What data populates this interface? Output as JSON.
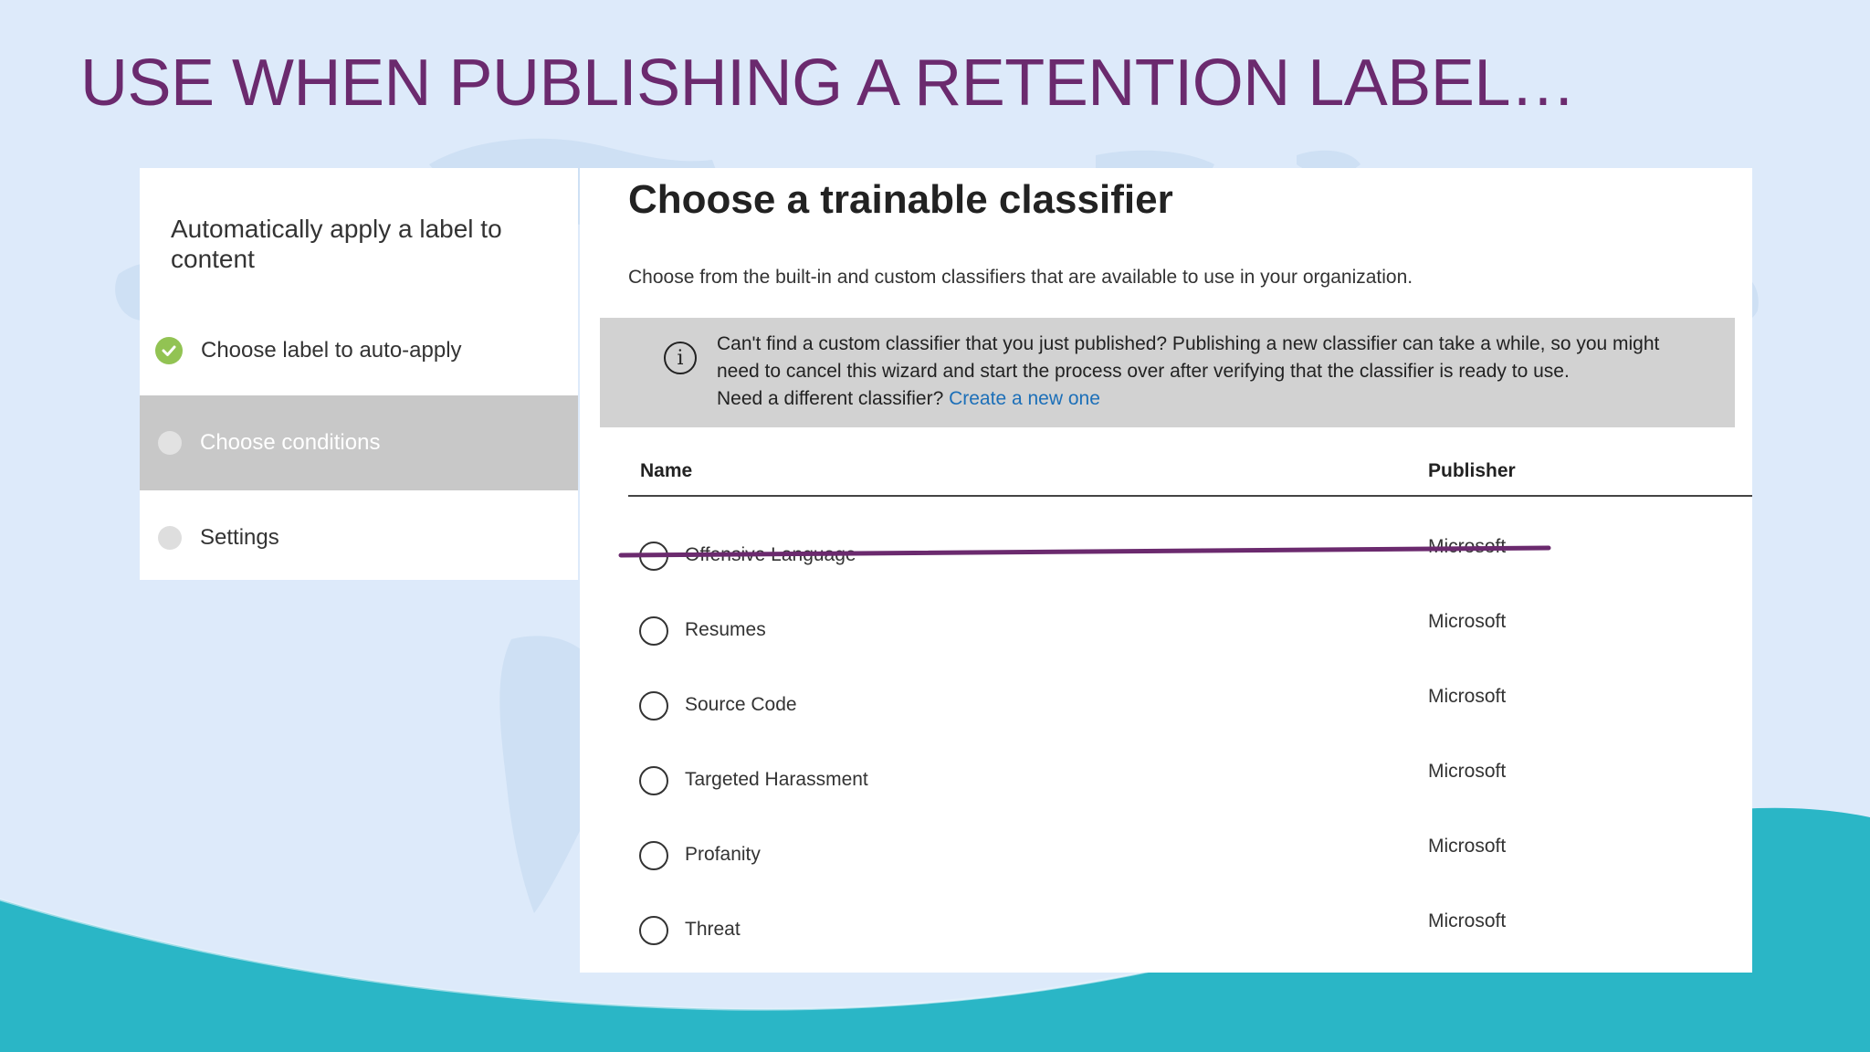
{
  "slide": {
    "title": "USE WHEN PUBLISHING A RETENTION LABEL…"
  },
  "wizard": {
    "heading": "Automatically apply a label to content",
    "steps": [
      {
        "label": "Choose label to auto-apply",
        "status": "completed"
      },
      {
        "label": "Choose conditions",
        "status": "current"
      },
      {
        "label": "Settings",
        "status": "pending"
      }
    ]
  },
  "main": {
    "title": "Choose a trainable classifier",
    "description": "Choose from the built-in and custom classifiers that are available to use in your organization.",
    "info": {
      "line1": "Can't find a custom classifier that you just published? Publishing a new classifier can take a while, so you might",
      "line2": "need to cancel this wizard and start the process over after verifying that the classifier is ready to use.",
      "line3_prefix": "Need a different classifier?",
      "link": "Create a new one"
    },
    "table": {
      "columns": {
        "name": "Name",
        "publisher": "Publisher"
      },
      "rows": [
        {
          "name": "Offensive Language",
          "publisher": "Microsoft",
          "struck_through": true
        },
        {
          "name": "Resumes",
          "publisher": "Microsoft"
        },
        {
          "name": "Source Code",
          "publisher": "Microsoft"
        },
        {
          "name": "Targeted Harassment",
          "publisher": "Microsoft"
        },
        {
          "name": "Profanity",
          "publisher": "Microsoft"
        },
        {
          "name": "Threat",
          "publisher": "Microsoft"
        }
      ]
    }
  },
  "colors": {
    "title": "#6b2a6e",
    "strike": "#6b2a6e",
    "check": "#92c353",
    "link": "#1c6fb8",
    "active_step": "#c8c8c8",
    "info_bg": "#d2d2d2",
    "wave": "#2ab6c6"
  }
}
